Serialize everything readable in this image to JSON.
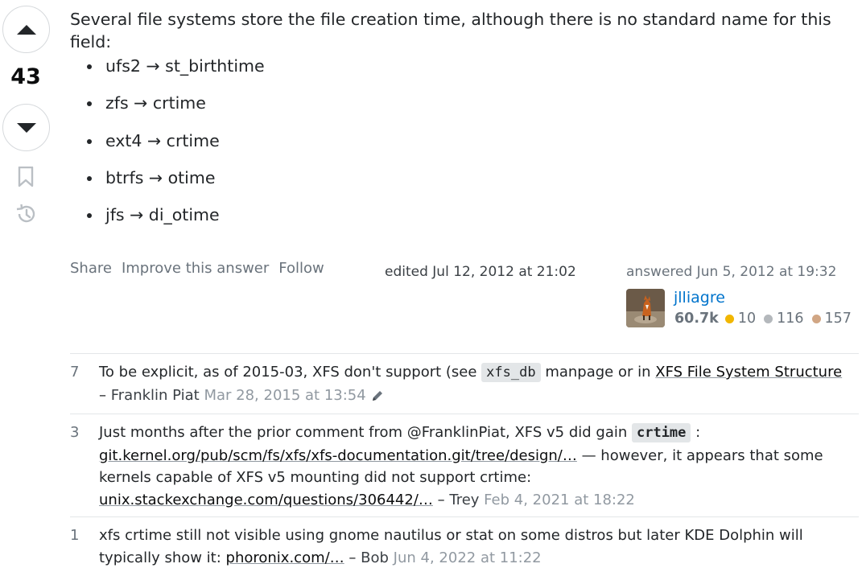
{
  "vote": {
    "count": "43"
  },
  "post": {
    "intro": "Several file systems store the file creation time, although there is no standard name for this field:",
    "bullets": [
      "ufs2 → st_birthtime",
      "zfs → crtime",
      "ext4 → crtime",
      "btrfs → otime",
      "jfs → di_otime"
    ]
  },
  "menu": {
    "share": "Share",
    "improve": "Improve this answer",
    "follow": "Follow"
  },
  "edited": "edited Jul 12, 2012 at 21:02",
  "answered": "answered Jun 5, 2012 at 19:32",
  "user": {
    "name": "jlliagre",
    "reputation": "60.7k",
    "badges": [
      {
        "type": "gold",
        "count": "10",
        "color": "#f1b600"
      },
      {
        "type": "silver",
        "count": "116",
        "color": "#b4b8bc"
      },
      {
        "type": "bronze",
        "count": "157",
        "color": "#d1a684"
      }
    ]
  },
  "comments": [
    {
      "score": "7",
      "text1": "To be explicit, as of 2015-03, XFS don't support (see ",
      "code": "xfs_db",
      "text2": " manpage or in ",
      "link": "XFS File System Structure",
      "dash": "– ",
      "user": "Franklin Piat",
      "date": "Mar 28, 2015 at 13:54"
    },
    {
      "score": "3",
      "text1": "Just months after the prior comment from @FranklinPiat, XFS v5 did gain ",
      "code": "crtime",
      "text2": " :",
      "link1": "git.kernel.org/pub/scm/fs/xfs/xfs-documentation.git/tree/design/…",
      "text3": " — however, it appears that some kernels capable of XFS v5 mounting did not support crtime: ",
      "link2": "unix.stackexchange.com/questions/306442/…",
      "dash": " – ",
      "user": "Trey",
      "date": "Feb 4, 2021 at 18:22"
    },
    {
      "score": "1",
      "text1": "xfs crtime still not visible using gnome nautilus or stat on some distros but later KDE Dolphin will typically show it: ",
      "link": "phoronix.com/…",
      "dash": " – ",
      "user": "Bob",
      "date": "Jun 4, 2022 at 11:22"
    }
  ],
  "colors": {
    "link_blue": "#0074cc",
    "muted": "#6a737c",
    "date": "#9199a1",
    "code_bg": "#e3e6e8"
  }
}
